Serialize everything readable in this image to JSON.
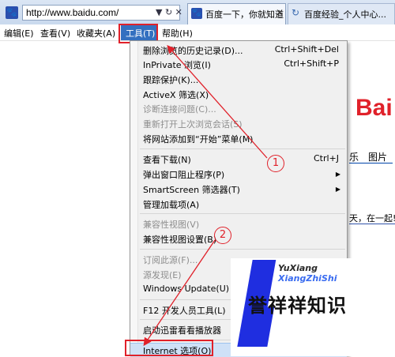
{
  "browser": {
    "address": "http://www.baidu.com/",
    "address_buttons": "▼ ↻ ✕",
    "favicon_glyph": "🐾",
    "tabs": [
      {
        "label": "百度一下，你就知道",
        "close": "✕"
      },
      {
        "label": "百度经验_个人中心..."
      }
    ]
  },
  "menubar": {
    "items": [
      "编辑(E)",
      "查看(V)",
      "收藏夹(A)",
      "工具(T)",
      "帮助(H)"
    ]
  },
  "tools_menu": {
    "items": [
      {
        "label": "删除浏览的历史记录(D)...",
        "shortcut": "Ctrl+Shift+Del",
        "enabled": true
      },
      {
        "label": "InPrivate 浏览(I)",
        "shortcut": "Ctrl+Shift+P",
        "enabled": true
      },
      {
        "label": "跟踪保护(K)...",
        "enabled": true
      },
      {
        "label": "ActiveX 筛选(X)",
        "enabled": true
      },
      {
        "label": "诊断连接问题(C)...",
        "enabled": false
      },
      {
        "label": "重新打开上次浏览会话(S)",
        "enabled": false
      },
      {
        "label": "将网站添加到“开始”菜单(M)",
        "enabled": true
      },
      {
        "label": "查看下载(N)",
        "shortcut": "Ctrl+J",
        "enabled": true
      },
      {
        "label": "弹出窗口阻止程序(P)",
        "submenu": true,
        "enabled": true
      },
      {
        "label": "SmartScreen 筛选器(T)",
        "submenu": true,
        "enabled": true
      },
      {
        "label": "管理加载项(A)",
        "enabled": true
      },
      {
        "label": "兼容性视图(V)",
        "enabled": false
      },
      {
        "label": "兼容性视图设置(B)",
        "enabled": true
      },
      {
        "label": "订阅此源(F)...",
        "enabled": false
      },
      {
        "label": "源发现(E)",
        "enabled": false
      },
      {
        "label": "Windows Update(U)",
        "enabled": true
      },
      {
        "label": "F12 开发人员工具(L)",
        "enabled": true
      },
      {
        "label": "启动迅雷看看播放器",
        "enabled": true
      },
      {
        "label": "Internet 选项(O)",
        "enabled": true,
        "highlighted": true
      }
    ],
    "submenu_arrow": "▶"
  },
  "page": {
    "logo": "Bai",
    "nav_music": "乐",
    "nav_image": "图片",
    "text": "天，在一起!"
  },
  "annotations": {
    "step1": "1",
    "step2": "2",
    "color": "#e0212a"
  },
  "watermark": {
    "latin_line1": "YuXiang",
    "latin_line2": "XiangZhiShi",
    "chinese": "誉祥祥知识"
  }
}
